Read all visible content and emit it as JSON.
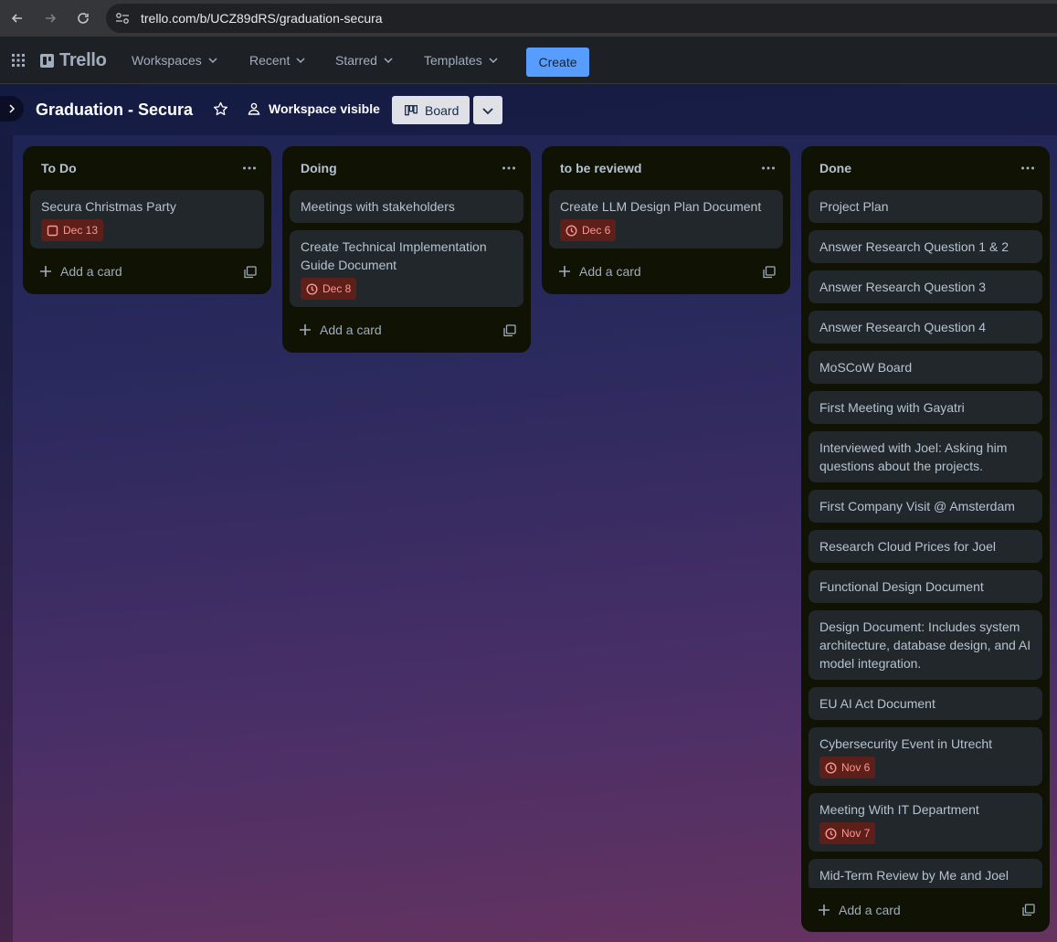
{
  "browser": {
    "url": "trello.com/b/UCZ89dRS/graduation-secura"
  },
  "header": {
    "logo": "Trello",
    "menu": [
      {
        "label": "Workspaces"
      },
      {
        "label": "Recent"
      },
      {
        "label": "Starred"
      },
      {
        "label": "Templates"
      }
    ],
    "create_label": "Create"
  },
  "board": {
    "title": "Graduation - Secura",
    "visibility_label": "Workspace visible",
    "view_label": "Board"
  },
  "lists": [
    {
      "title": "To Do",
      "add_card_label": "Add a card",
      "cards": [
        {
          "title": "Secura Christmas Party",
          "due": "Dec 13",
          "due_icon": "checkbox-icon"
        }
      ]
    },
    {
      "title": "Doing",
      "add_card_label": "Add a card",
      "cards": [
        {
          "title": "Meetings with stakeholders"
        },
        {
          "title": "Create Technical Implementation Guide Document",
          "due": "Dec 8",
          "due_icon": "clock-icon"
        }
      ]
    },
    {
      "title": "to be reviewd",
      "add_card_label": "Add a card",
      "cards": [
        {
          "title": "Create LLM Design Plan Document",
          "due": "Dec 6",
          "due_icon": "clock-icon"
        }
      ]
    },
    {
      "title": "Done",
      "add_card_label": "Add a card",
      "cards": [
        {
          "title": "Project Plan"
        },
        {
          "title": "Answer Research Question 1 & 2"
        },
        {
          "title": "Answer Research Question 3"
        },
        {
          "title": "Answer Research Question 4"
        },
        {
          "title": "MoSCoW Board"
        },
        {
          "title": "First Meeting with Gayatri"
        },
        {
          "title": "Interviewed with Joel: Asking him questions about the projects."
        },
        {
          "title": "First Company Visit @ Amsterdam"
        },
        {
          "title": "Research Cloud Prices for Joel"
        },
        {
          "title": "Functional Design Document"
        },
        {
          "title": "Design Document: Includes system architecture, database design, and AI model integration."
        },
        {
          "title": "EU AI Act Document"
        },
        {
          "title": "Cybersecurity Event in Utrecht",
          "due": "Nov 6",
          "due_icon": "clock-icon"
        },
        {
          "title": "Meeting With IT Department",
          "due": "Nov 7",
          "due_icon": "clock-icon"
        },
        {
          "title": "Mid-Term Review by Me and Joel"
        }
      ]
    }
  ],
  "colors": {
    "accent": "#579dff",
    "list_bg": "#101204",
    "card_bg": "#22272b",
    "due_badge_bg": "#5d1f1a",
    "due_badge_text": "#fd9891"
  }
}
